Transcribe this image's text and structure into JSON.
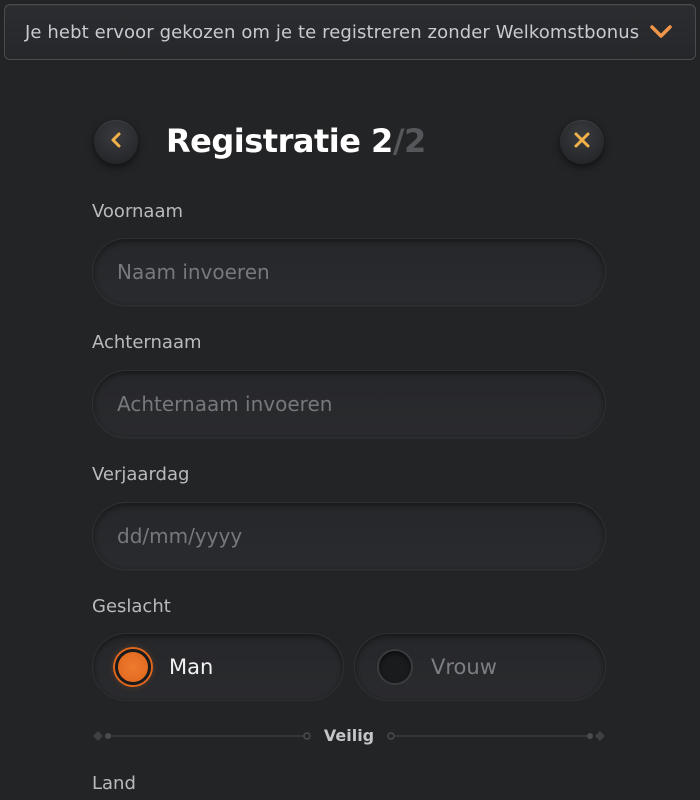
{
  "banner": {
    "text": "Je hebt ervoor gekozen om je te registreren zonder Welkomstbonus",
    "icon": "chevron-down-icon",
    "accent": "#f0954a"
  },
  "header": {
    "title": "Registratie 2",
    "step_total": "/2",
    "back_icon": "chevron-left-icon",
    "close_icon": "close-icon",
    "icon_color": "#f3b14a"
  },
  "form": {
    "first_name": {
      "label": "Voornaam",
      "placeholder": "Naam invoeren",
      "value": ""
    },
    "last_name": {
      "label": "Achternaam",
      "placeholder": "Achternaam invoeren",
      "value": ""
    },
    "birthday": {
      "label": "Verjaardag",
      "placeholder": "dd/mm/yyyy",
      "value": ""
    },
    "gender": {
      "label": "Geslacht",
      "options": [
        {
          "label": "Man",
          "selected": true
        },
        {
          "label": "Vrouw",
          "selected": false
        }
      ],
      "selected_color": "#ee7b2e"
    },
    "divider_label": "Veilig",
    "country": {
      "label": "Land"
    }
  }
}
